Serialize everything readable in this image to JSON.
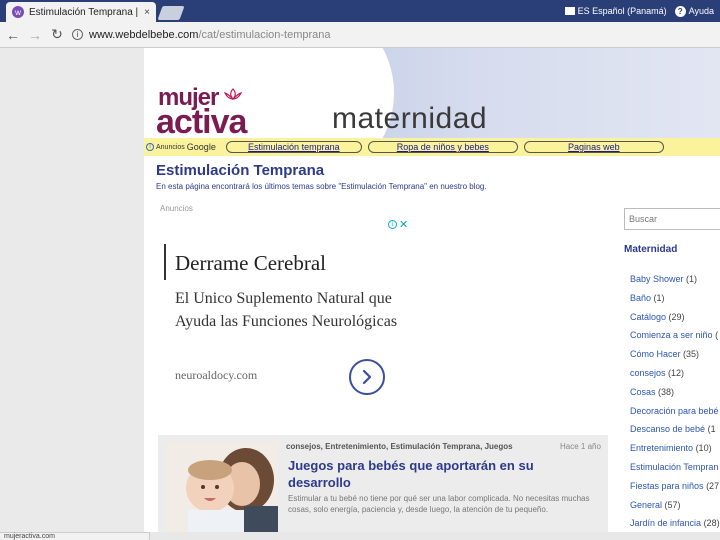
{
  "browser": {
    "tab_title": "Estimulación Temprana |",
    "tab_close": "×",
    "favicon": "w",
    "language": "ES Español (Panamá)",
    "help": "Ayuda",
    "help_glyph": "?",
    "url_host": "www.webdelbebe.com",
    "url_path": "/cat/estimulacion-temprana",
    "status_text": "mujeractiva.com"
  },
  "header": {
    "logo_top": "mujer",
    "logo_bottom": "activa",
    "section": "maternidad",
    "brand_color": "#7a1c52"
  },
  "adbar": {
    "label": "Anuncios",
    "google": "Google",
    "links": [
      "Estimulación temprana",
      "Ropa de niños y bebes",
      "Paginas web"
    ]
  },
  "category": {
    "title": "Estimulación Temprana",
    "description": "En esta página encontrará los últimos temas sobre \"Estimulación Temprana\" en nuestro blog."
  },
  "ad": {
    "label": "Anuncios",
    "headline": "Derrame Cerebral",
    "body": "El Unico Suplemento Natural que Ayuda las Funciones Neurológicas",
    "domain": "neuroaldocy.com"
  },
  "post": {
    "categories": "consejos, Entretenimiento, Estimulación Temprana, Juegos",
    "date": "Hace 1 año",
    "title": "Juegos para bebés que aportarán en su desarrollo",
    "excerpt": "Estimular a tu bebé no tiene por qué ser una labor complicada. No necesitas muchas cosas, solo energía, paciencia y, desde luego, la atención de tu pequeño."
  },
  "sidebar": {
    "search_placeholder": "Buscar",
    "heading": "Maternidad",
    "items": [
      {
        "label": "Baby Shower",
        "count": "(1)"
      },
      {
        "label": "Baño",
        "count": "(1)"
      },
      {
        "label": "Catálogo",
        "count": "(29)"
      },
      {
        "label": "Comienza a ser niño",
        "count": "("
      },
      {
        "label": "Cómo Hacer",
        "count": "(35)"
      },
      {
        "label": "consejos",
        "count": "(12)"
      },
      {
        "label": "Cosas",
        "count": "(38)"
      },
      {
        "label": "Decoración para bebé",
        "count": ""
      },
      {
        "label": "Descanso de bebé",
        "count": "(1"
      },
      {
        "label": "Entretenimiento",
        "count": "(10)"
      },
      {
        "label": "Estimulación Tempran",
        "count": ""
      },
      {
        "label": "Fiestas para niños",
        "count": "(27"
      },
      {
        "label": "General",
        "count": "(57)"
      },
      {
        "label": "Jardín de infancia",
        "count": "(28)"
      }
    ]
  }
}
